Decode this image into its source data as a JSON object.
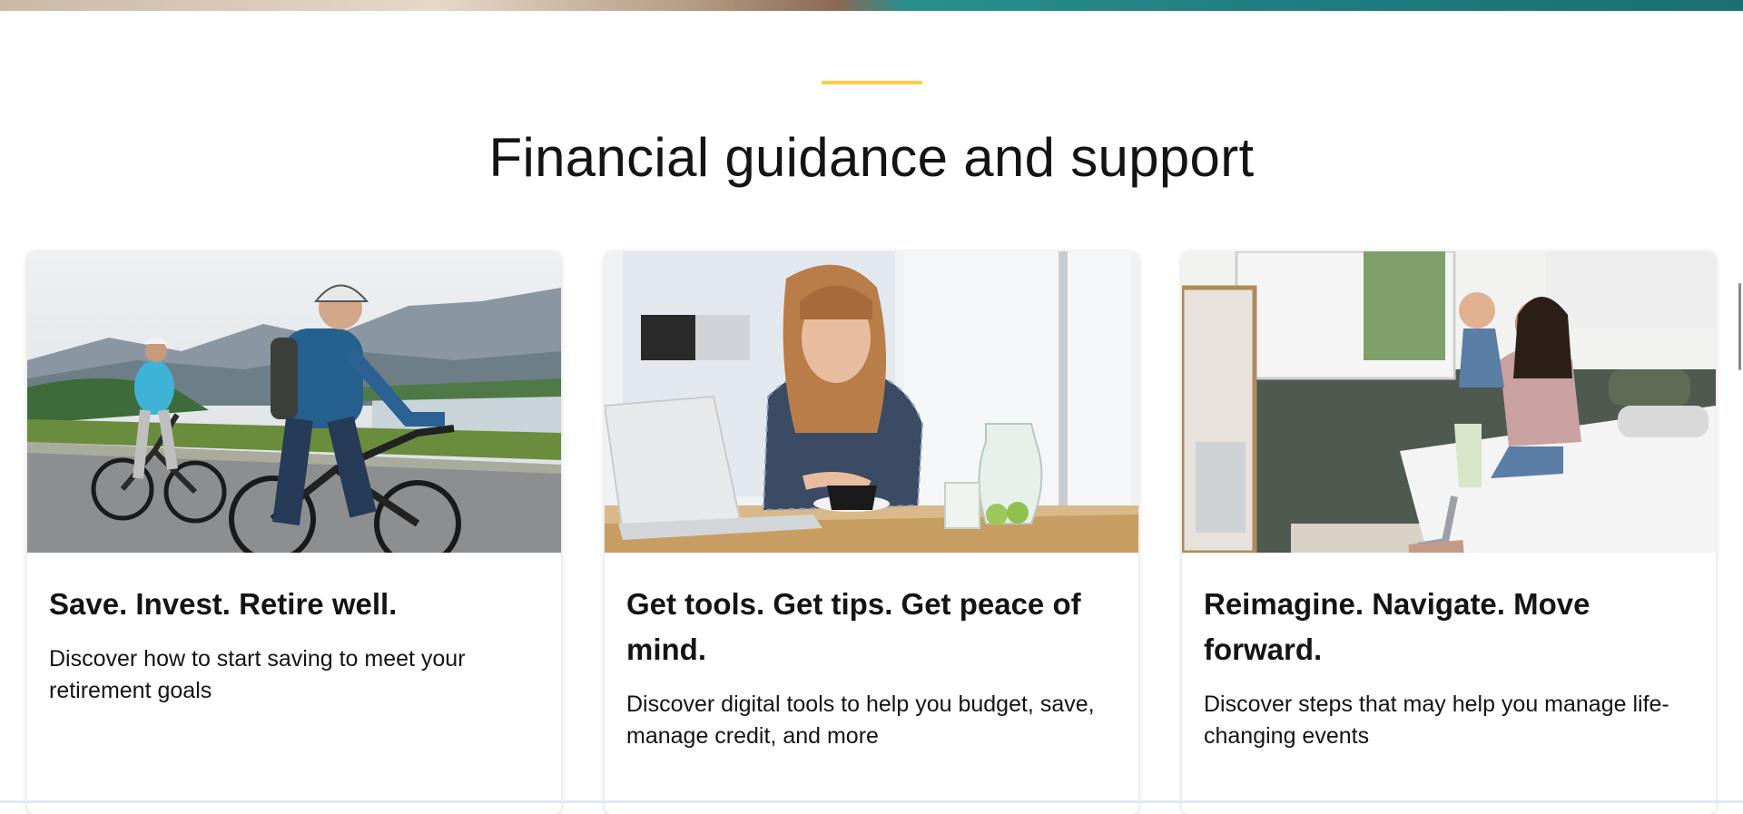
{
  "section": {
    "title": "Financial guidance and support",
    "accent_color": "#ffcd41"
  },
  "cards": [
    {
      "image_icon": "photo-cyclists",
      "title": "Save. Invest. Retire well.",
      "description": "Discover how to start saving to meet your retirement goals"
    },
    {
      "image_icon": "photo-woman-laptop",
      "title": "Get tools. Get tips. Get peace of mind.",
      "description": "Discover digital tools to help you budget, save, manage credit, and more"
    },
    {
      "image_icon": "photo-mother-child",
      "title": "Reimagine. Navigate. Move forward.",
      "description": "Discover steps that may help you manage life-changing events"
    }
  ]
}
